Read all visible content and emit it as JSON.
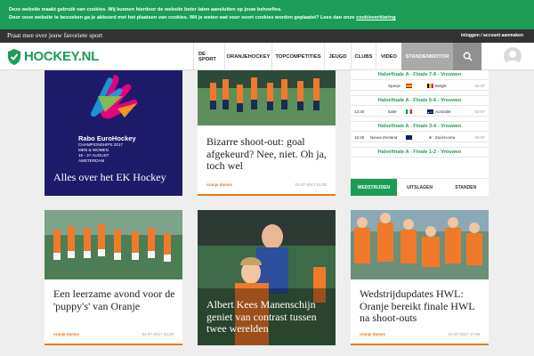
{
  "cookie": {
    "line1": "Deze website maakt gebruik van cookies. Wij kunnen hierdoor de website beter laten aansluiten op jouw behoeftes.",
    "line2": "Door onze website te bezoeken ga je akkoord met het plaatsen van cookies. Wil je weten wat voor soort cookies worden geplaatst? Lees dan onze",
    "link": "cookieverklaring"
  },
  "topbar": {
    "left": "Praat mee over jouw favoriete sport",
    "right": "inloggen / account aanmaken"
  },
  "nav": {
    "logo": "HOCKEY.NL",
    "items": [
      "DE SPORT",
      "ORANJEHOCKEY",
      "TOPCOMPETITIES",
      "JEUGD",
      "CLUBS",
      "VIDEO",
      "STANDENMOTOR"
    ]
  },
  "cards": {
    "ek": {
      "title": "Alles over het EK Hockey",
      "poster": {
        "brand1": "Rabo",
        "brand2": "EuroHockey",
        "l1": "CHAMPIONSHIPS 2017",
        "l2": "MEN & WOMEN",
        "l3": "18 - 27 AUGUST",
        "l4": "AMSTERDAM"
      }
    },
    "shootout": {
      "title": "Bizarre shoot-out: goal afgekeurd? Nee, niet. Oh ja, toch wel",
      "tag": "oranje dames",
      "date": "02-07-2017 01:00"
    },
    "puppy": {
      "title": "Een leerzame avond voor de 'puppy's' van Oranje",
      "tag": "oranje dames",
      "date": "01-07-2017 22:20"
    },
    "albert": {
      "title": "Albert Kees Manenschijn geniet van contrast tussen twee werelden"
    },
    "wedstrijd": {
      "title": "Wedstrijdupdates HWL: Oranje bereikt finale HWL na shoot-outs",
      "tag": "oranje dames",
      "date": "01-07-2017 17:09"
    }
  },
  "results": {
    "blocks": [
      {
        "header": "Halvefinale A - Finale 7-8 - Vrouwen",
        "time": "",
        "home": "Spanje",
        "away": "België",
        "date": "02-07"
      },
      {
        "header": "Halvefinale A - Finale 5-6 - Vrouwen",
        "time": "13:30",
        "home": "Italië",
        "away": "Australië",
        "date": "02-07"
      },
      {
        "header": "Halvefinale A - Finale 3-4 - Vrouwen",
        "time": "15:45",
        "home": "Nieuw-Zeeland",
        "away": "Zuid-Korea",
        "date": "02-07"
      },
      {
        "header": "Halvefinale A - Finale 1-2 - Vrouwen"
      }
    ],
    "tabs": [
      "WEDSTRIJDEN",
      "UITSLAGEN",
      "STANDEN"
    ]
  }
}
